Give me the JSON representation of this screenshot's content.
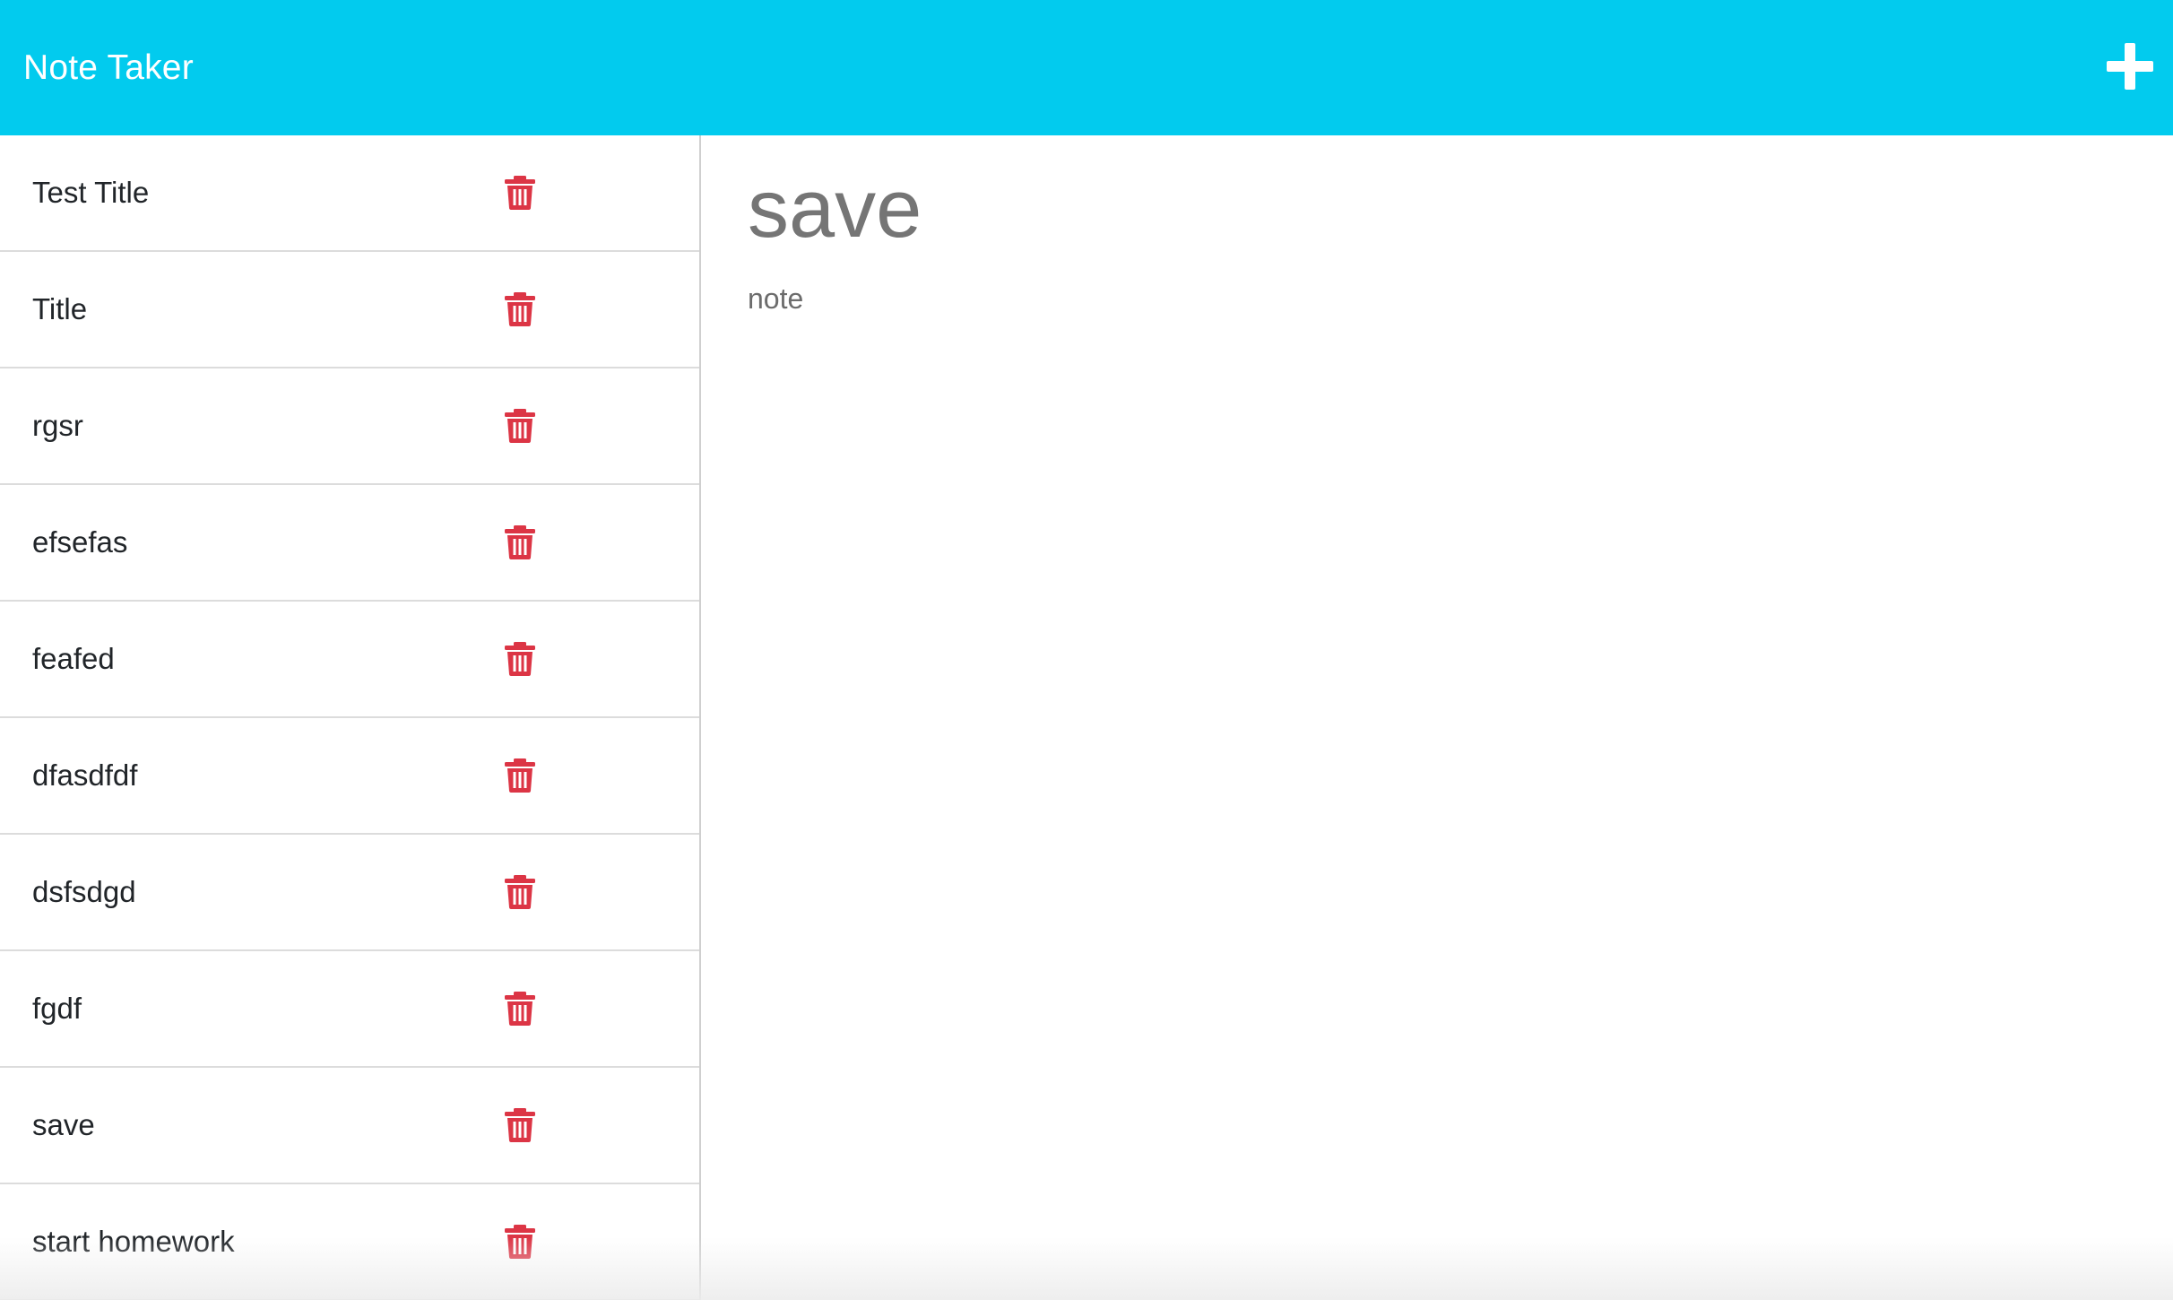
{
  "header": {
    "title": "Note Taker",
    "new_note_icon": "plus-icon",
    "background_color": "#02cbee"
  },
  "notes": [
    {
      "title": "Test Title"
    },
    {
      "title": "Title"
    },
    {
      "title": "rgsr"
    },
    {
      "title": "efsefas"
    },
    {
      "title": "feafed"
    },
    {
      "title": "dfasdfdf"
    },
    {
      "title": "dsfsdgd"
    },
    {
      "title": "fgdf"
    },
    {
      "title": "save"
    },
    {
      "title": "start homework"
    }
  ],
  "delete_icon": "trash-icon",
  "delete_icon_color": "#dc3545",
  "active_note": {
    "title": "save",
    "text": "note"
  }
}
